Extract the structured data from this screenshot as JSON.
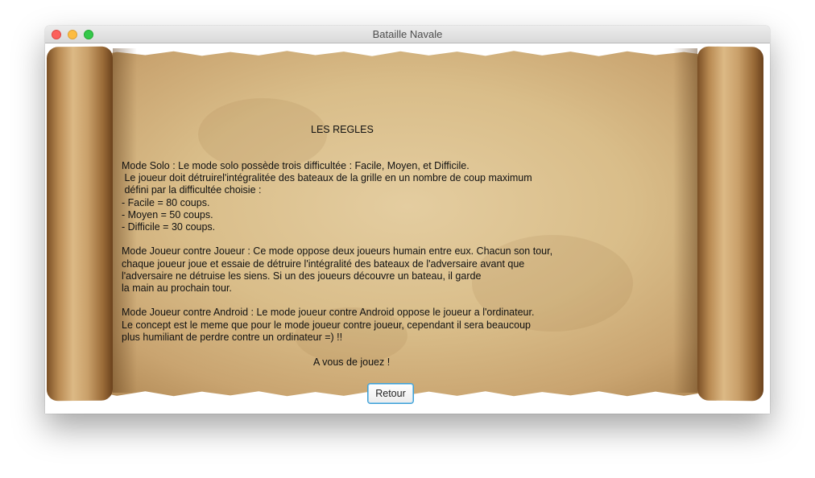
{
  "window": {
    "title": "Bataille Navale"
  },
  "rules": {
    "heading": "LES REGLES",
    "lines": [
      "Mode Solo : Le mode solo possède trois difficultée : Facile, Moyen, et Difficile.",
      " Le joueur doit détruirel'intégralitée des bateaux de la grille en un nombre de coup maximum",
      " défini par la difficultée choisie :",
      "- Facile = 80 coups.",
      "- Moyen = 50 coups.",
      "- Difficile = 30 coups.",
      "",
      "Mode Joueur contre Joueur : Ce mode oppose deux joueurs humain entre eux. Chacun son tour,",
      "chaque joueur joue et essaie de détruire l'intégralité des bateaux de l'adversaire avant que",
      "l'adversaire ne détruise les siens. Si un des joueurs découvre un bateau, il garde",
      "la main au prochain tour.",
      "",
      "Mode Joueur contre Android : Le mode joueur contre Android oppose le joueur a l'ordinateur.",
      "Le concept est le meme que pour le mode joueur contre joueur, cependant il sera beaucoup",
      "plus humiliant de perdre contre un ordinateur =) !!"
    ],
    "closing": "A vous de jouez !"
  },
  "buttons": {
    "back_label": "Retour"
  },
  "colors": {
    "close": "#fc605b",
    "minimize": "#fdbc40",
    "maximize": "#34c84a",
    "button_focus": "#3ea0d6",
    "parchment": "#d9bd89"
  }
}
